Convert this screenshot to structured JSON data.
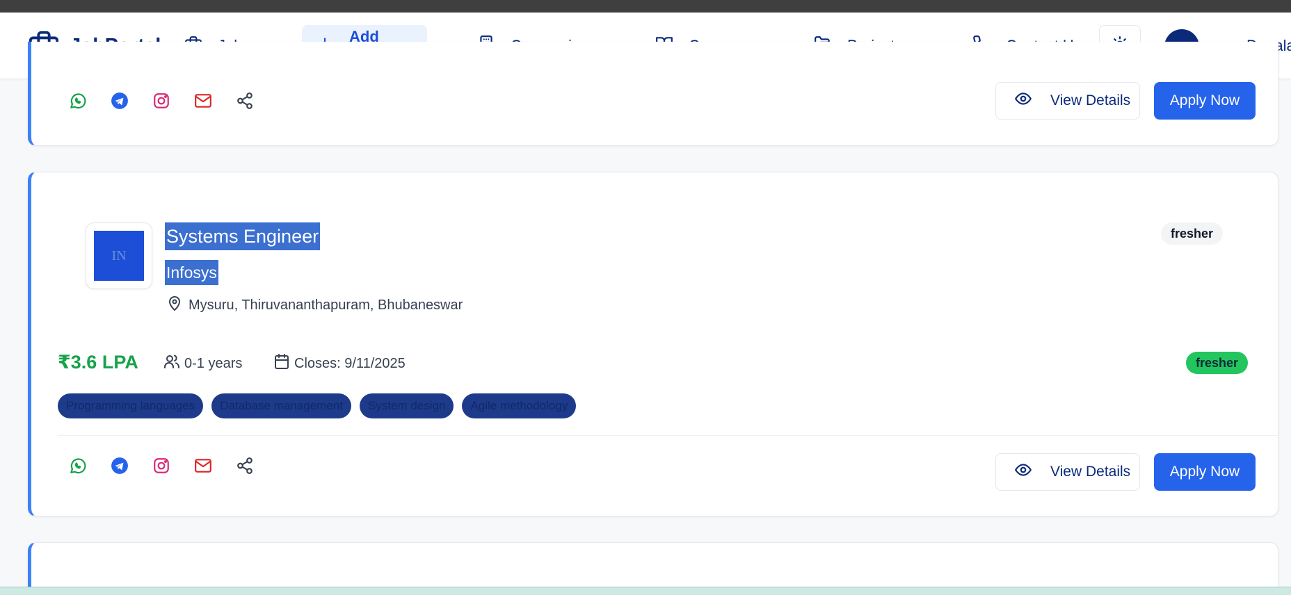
{
  "brand": {
    "name": "JobPortal",
    "icon": "briefcase-icon"
  },
  "nav": {
    "jobs": "Jobs",
    "add_jobs": "Add Jobs",
    "companies": "Companies",
    "courses": "Courses",
    "projects": "Projects",
    "contact": "Contact Us"
  },
  "user": {
    "name": "ram Degala"
  },
  "actions": {
    "view_details": "View Details",
    "apply_now": "Apply Now"
  },
  "job": {
    "title": "Systems Engineer",
    "company": "Infosys",
    "logo_text": "IN",
    "location": "Mysuru, Thiruvananthapuram, Bhubaneswar",
    "badge_top": "fresher",
    "salary": "₹3.6 LPA",
    "experience": "0-1 years",
    "closes": "Closes: 9/11/2025",
    "badge_bottom": "fresher",
    "tags": [
      "Programming languages",
      "Database management",
      "System design",
      "Agile methodology"
    ]
  },
  "colors": {
    "primary": "#2563eb",
    "brand_navy": "#0b2a7a",
    "accent_border": "#3b82f6",
    "salary_green": "#16a34a",
    "badge_green": "#22c55e"
  }
}
